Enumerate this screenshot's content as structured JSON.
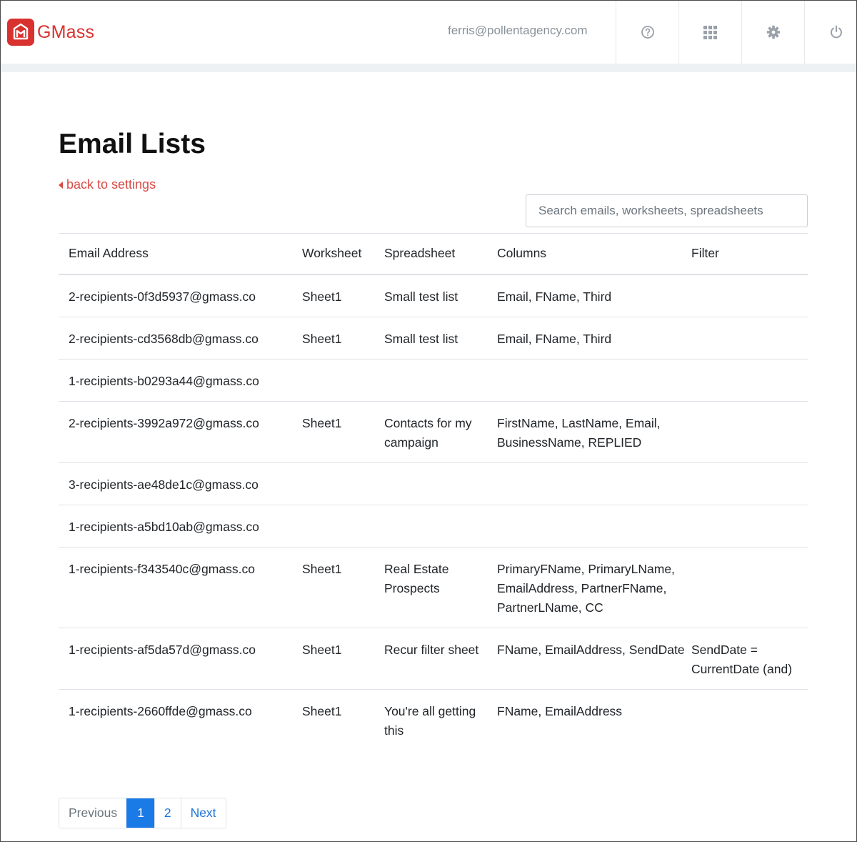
{
  "brand": {
    "name": "GMass"
  },
  "header": {
    "user_email": "ferris@pollentagency.com",
    "icons": [
      "help-icon",
      "apps-grid-icon",
      "gear-icon",
      "power-icon"
    ],
    "colors": {
      "brand_red": "#d8312f",
      "icon_gray": "#9aa1a8"
    }
  },
  "page": {
    "title": "Email Lists",
    "back_label": "back to settings",
    "search_placeholder": "Search emails, worksheets, spreadsheets"
  },
  "table": {
    "headers": [
      "Email Address",
      "Worksheet",
      "Spreadsheet",
      "Columns",
      "Filter"
    ],
    "rows": [
      {
        "email": "2-recipients-0f3d5937@gmass.co",
        "worksheet": "Sheet1",
        "spreadsheet": "Small test list",
        "columns": "Email, FName, Third",
        "filter": ""
      },
      {
        "email": "2-recipients-cd3568db@gmass.co",
        "worksheet": "Sheet1",
        "spreadsheet": "Small test list",
        "columns": "Email, FName, Third",
        "filter": ""
      },
      {
        "email": "1-recipients-b0293a44@gmass.co",
        "worksheet": "",
        "spreadsheet": "",
        "columns": "",
        "filter": ""
      },
      {
        "email": "2-recipients-3992a972@gmass.co",
        "worksheet": "Sheet1",
        "spreadsheet": "Contacts for my campaign",
        "columns": "FirstName, LastName, Email, BusinessName, REPLIED",
        "filter": ""
      },
      {
        "email": "3-recipients-ae48de1c@gmass.co",
        "worksheet": "",
        "spreadsheet": "",
        "columns": "",
        "filter": ""
      },
      {
        "email": "1-recipients-a5bd10ab@gmass.co",
        "worksheet": "",
        "spreadsheet": "",
        "columns": "",
        "filter": ""
      },
      {
        "email": "1-recipients-f343540c@gmass.co",
        "worksheet": "Sheet1",
        "spreadsheet": "Real Estate Prospects",
        "columns": "PrimaryFName, PrimaryLName, EmailAddress, PartnerFName, PartnerLName, CC",
        "filter": ""
      },
      {
        "email": "1-recipients-af5da57d@gmass.co",
        "worksheet": "Sheet1",
        "spreadsheet": "Recur filter sheet",
        "columns": "FName, EmailAddress, SendDate",
        "filter": "SendDate = CurrentDate (and)"
      },
      {
        "email": "1-recipients-2660ffde@gmass.co",
        "worksheet": "Sheet1",
        "spreadsheet": "You're all getting this",
        "columns": "FName, EmailAddress",
        "filter": ""
      }
    ]
  },
  "pagination": {
    "previous": "Previous",
    "pages": [
      "1",
      "2"
    ],
    "current": "1",
    "next": "Next"
  }
}
